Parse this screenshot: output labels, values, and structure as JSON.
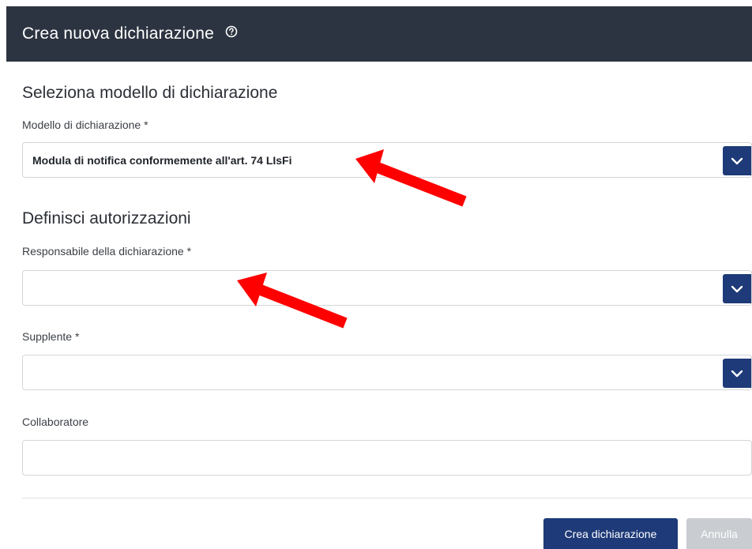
{
  "header": {
    "title": "Crea nuova dichiarazione",
    "help_icon": "question-circle-icon"
  },
  "section_model": {
    "title": "Seleziona modello di dichiarazione",
    "model_label": "Modello di dichiarazione *",
    "model_value": "Modula di notifica conformemente all'art. 74 LIsFi"
  },
  "section_permissions": {
    "title": "Definisci autorizzazioni",
    "responsible_label": "Responsabile della dichiarazione *",
    "responsible_value": "",
    "deputy_label": "Supplente *",
    "deputy_value": "",
    "collaborator_label": "Collaboratore",
    "collaborator_value": ""
  },
  "actions": {
    "create_label": "Crea dichiarazione",
    "cancel_label": "Annulla"
  },
  "icons": {
    "dropdown": "chevron-down-icon",
    "annotation": "red-arrow-icon"
  },
  "colors": {
    "header_bg": "#2d3441",
    "primary": "#1e3a78",
    "secondary": "#c9ccd1",
    "annotation": "#ff0000"
  }
}
